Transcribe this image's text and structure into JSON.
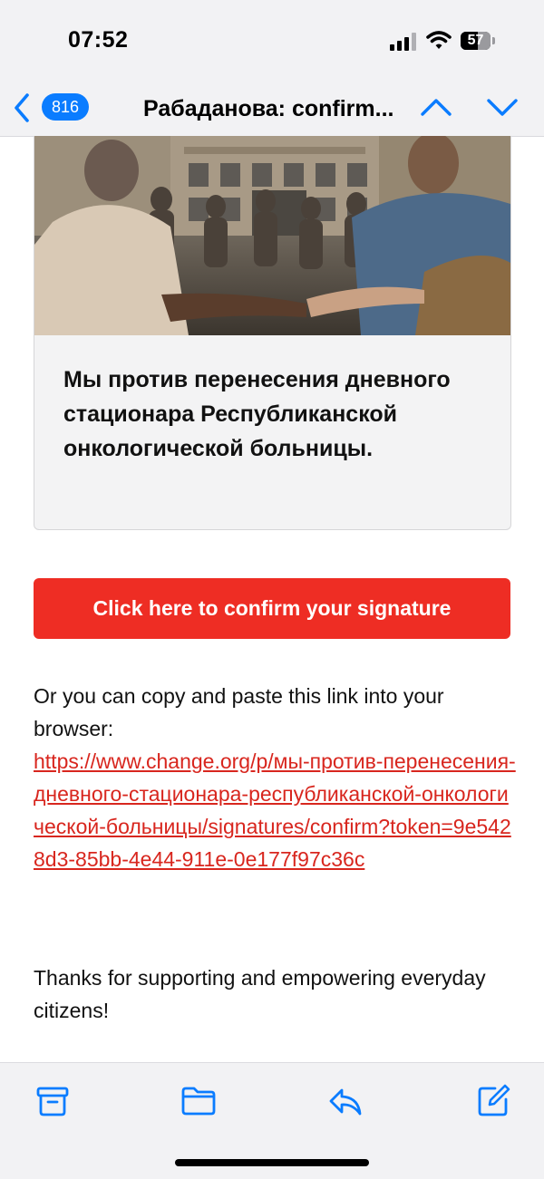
{
  "status_bar": {
    "time": "07:52",
    "battery_level": "57",
    "icons": [
      "signal-icon",
      "wifi-icon",
      "battery-icon"
    ]
  },
  "nav": {
    "back_icon": "chevron-left-icon",
    "unread_count": "816",
    "title": "Рабаданова: confirm...",
    "prev_icon": "chevron-up-icon",
    "next_icon": "chevron-down-icon",
    "accent_color": "#0a7cff"
  },
  "card": {
    "image": "photo of people holding hands in a circle in front of a building",
    "title": "Мы против перенесения дневного стационара Республиканской онкологической больницы."
  },
  "confirm_button": {
    "label": "Click here to confirm your signature",
    "color": "#ee2d24"
  },
  "copy_text": "Or you can copy and paste this link into your browser:",
  "link": {
    "text": "https://www.change.org/p/мы-против-перенесения-дневного-стационара-республиканской-онкологической-больницы/signatures/confirm?token=9e5428d3-85bb-4e44-911e-0e177f97c36c",
    "color": "#d8261e"
  },
  "thanks_text": "Thanks for supporting and empowering everyday citizens!",
  "toolbar": {
    "icons": [
      "archive-icon",
      "folder-icon",
      "reply-icon",
      "compose-icon"
    ]
  }
}
